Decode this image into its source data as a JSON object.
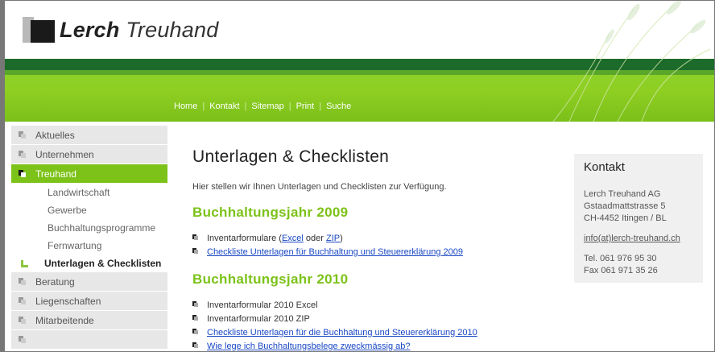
{
  "brand": {
    "name_bold": "Lerch",
    "name_light": "Treuhand"
  },
  "top_nav": [
    "Home",
    "Kontakt",
    "Sitemap",
    "Print",
    "Suche"
  ],
  "side_nav": {
    "items": [
      {
        "label": "Aktuelles"
      },
      {
        "label": "Unternehmen"
      },
      {
        "label": "Treuhand"
      },
      {
        "label": "Beratung"
      },
      {
        "label": "Liegenschaften"
      },
      {
        "label": "Mitarbeitende"
      }
    ],
    "sub_items": [
      "Landwirtschaft",
      "Gewerbe",
      "Buchhaltungsprogramme",
      "Fernwartung",
      "Unterlagen & Checklisten"
    ]
  },
  "content": {
    "title": "Unterlagen & Checklisten",
    "intro": "Hier stellen wir Ihnen Unterlagen und Checklisten zur Verfügung.",
    "section_2009": {
      "title": "Buchhaltungsjahr 2009",
      "item1_prefix": "Inventarformulare (",
      "item1_link1": "Excel",
      "item1_mid": " oder ",
      "item1_link2": "ZIP",
      "item1_suffix": ")",
      "item2": "Checkliste Unterlagen für Buchhaltung und Steuererklärung 2009"
    },
    "section_2010": {
      "title": "Buchhaltungsjahr 2010",
      "items": [
        "Inventarformular 2010 Excel",
        "Inventarformular 2010 ZIP",
        "Checkliste Unterlagen für die Buchhaltung und Steuererklärung 2010",
        "Wie lege ich Buchhaltungsbelege zweckmässig ab?"
      ]
    }
  },
  "contact": {
    "title": "Kontakt",
    "company": "Lerch Treuhand AG",
    "street": "Gstaadmattstrasse 5",
    "city": "CH-4452 Itingen / BL",
    "email": "info(at)lerch-treuhand.ch",
    "tel": "Tel. 061 976 95 30",
    "fax": "Fax 061 971 35 26"
  },
  "colors": {
    "brand_green": "#7cc218",
    "dark_green": "#1c6b2a",
    "link_blue": "#1a48c4"
  }
}
